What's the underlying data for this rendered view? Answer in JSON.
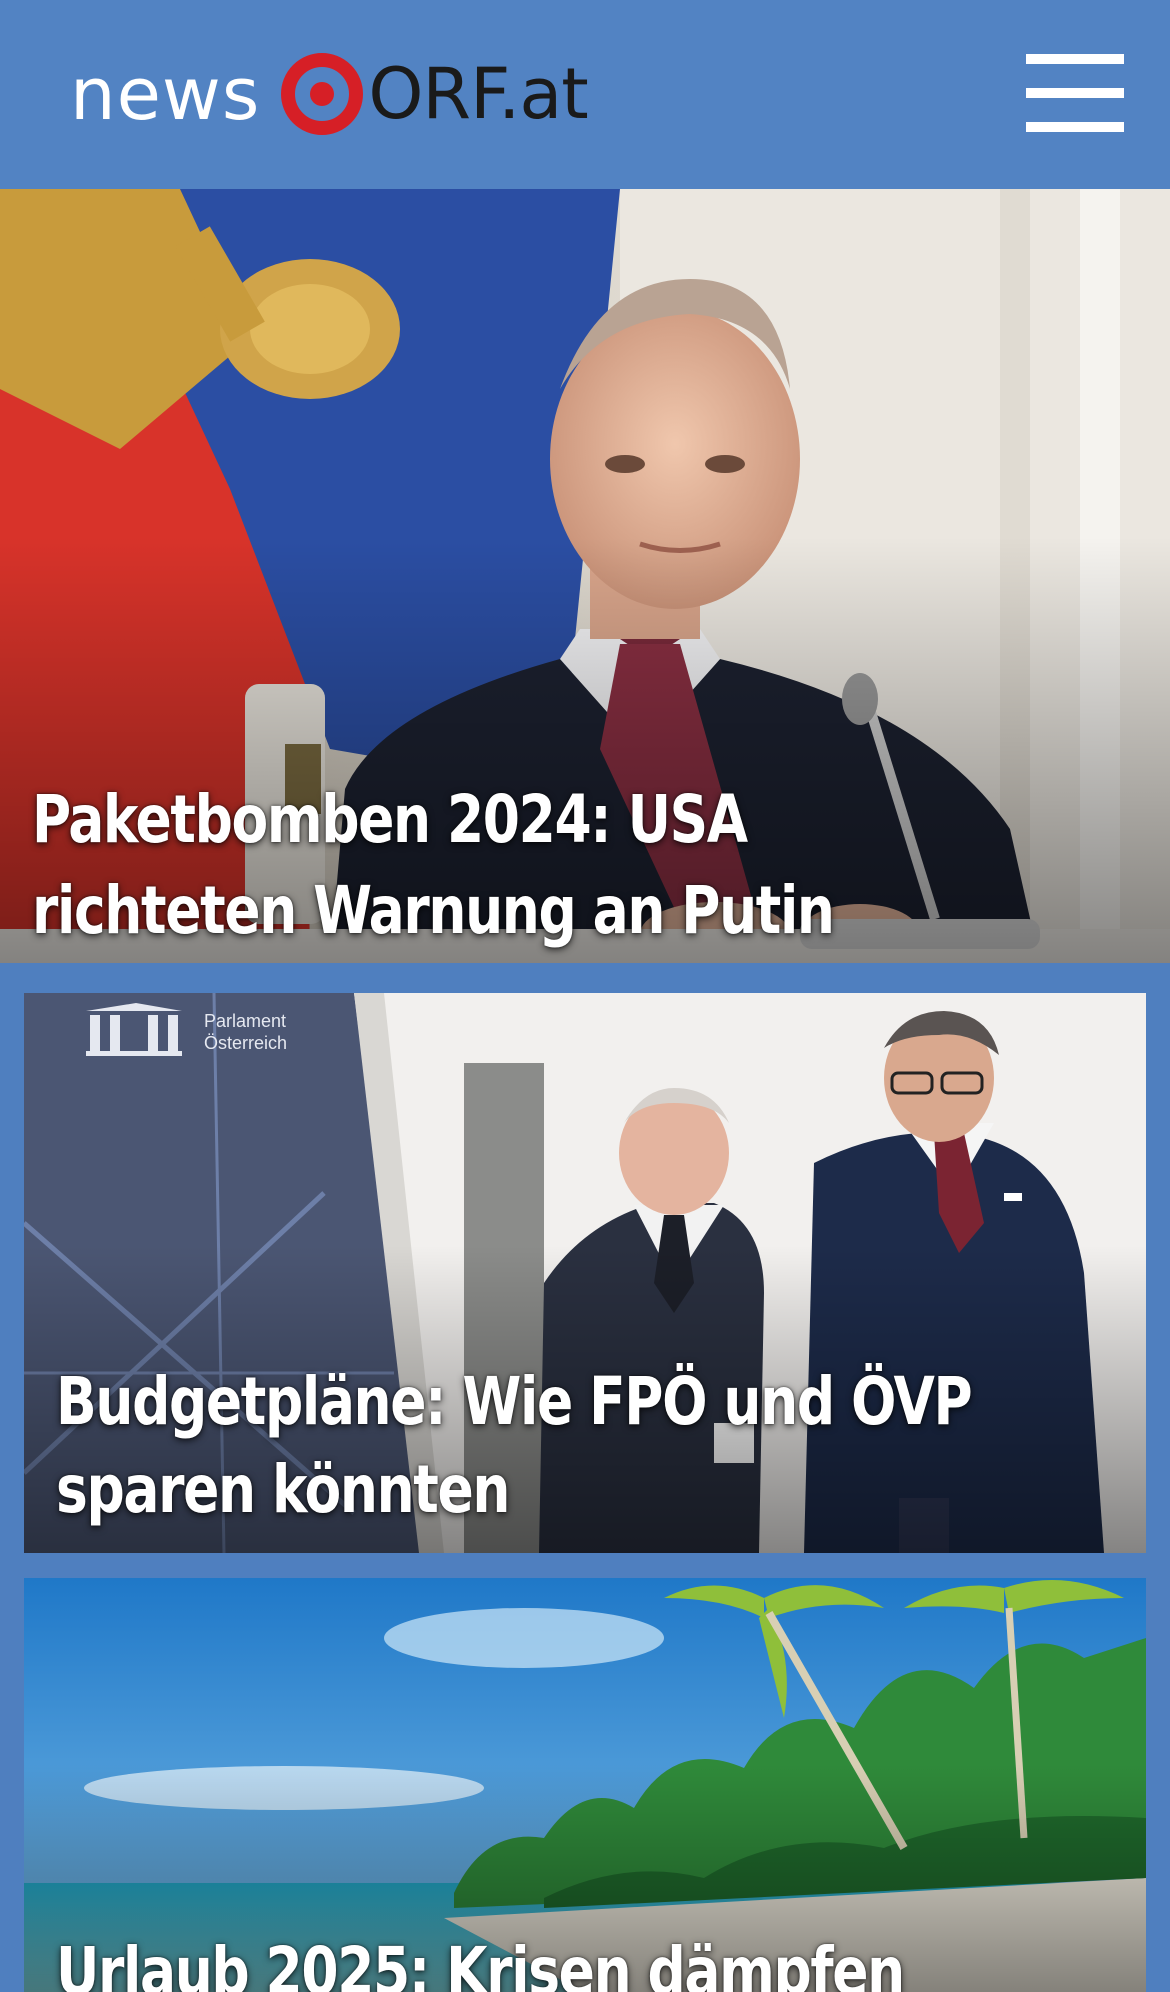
{
  "app": {
    "logo_prefix": "news",
    "logo_suffix": "ORF.at",
    "brand_red": "#d61f26",
    "header_blue": "#5283c3",
    "menu_icon": "hamburger-menu-icon"
  },
  "stories": [
    {
      "title": "Paketbomben 2024: USA richteten Warnung an Putin",
      "image": "photo-putin-at-desk"
    },
    {
      "title": "Budgetpläne: Wie FPÖ und ÖVP sparen könnten",
      "image": "photo-politicians-parliament",
      "image_text_line1": "Parlament",
      "image_text_line2": "Österreich"
    },
    {
      "title": "Urlaub 2025: Krisen dämpfen",
      "image": "photo-tropical-beach"
    }
  ]
}
